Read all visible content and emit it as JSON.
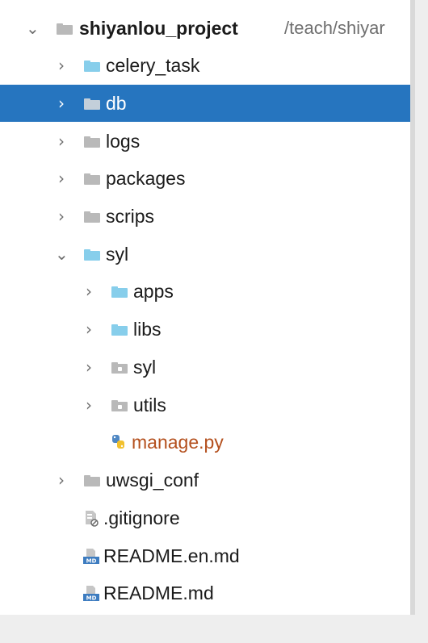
{
  "tree": {
    "root": {
      "name": "shiyanlou_project",
      "path": "/teach/shiyar",
      "expanded": true
    },
    "items": [
      {
        "name": "celery_task",
        "type": "folder",
        "icon": "blue-folder-icon",
        "expanded": false
      },
      {
        "name": "db",
        "type": "folder",
        "icon": "gray-folder-icon",
        "expanded": false,
        "selected": true
      },
      {
        "name": "logs",
        "type": "folder",
        "icon": "gray-folder-icon",
        "expanded": false
      },
      {
        "name": "packages",
        "type": "folder",
        "icon": "gray-folder-icon",
        "expanded": false
      },
      {
        "name": "scrips",
        "type": "folder",
        "icon": "gray-folder-icon",
        "expanded": false
      },
      {
        "name": "syl",
        "type": "folder",
        "icon": "blue-folder-icon",
        "expanded": true
      },
      {
        "name": "apps",
        "type": "folder",
        "icon": "blue-folder-icon",
        "expanded": false
      },
      {
        "name": "libs",
        "type": "folder",
        "icon": "blue-folder-icon",
        "expanded": false
      },
      {
        "name": "syl",
        "type": "folder",
        "icon": "package-folder-icon",
        "expanded": false
      },
      {
        "name": "utils",
        "type": "folder",
        "icon": "package-folder-icon",
        "expanded": false
      },
      {
        "name": "manage.py",
        "type": "file",
        "icon": "python-file-icon"
      },
      {
        "name": "uwsgi_conf",
        "type": "folder",
        "icon": "gray-folder-icon",
        "expanded": false
      },
      {
        "name": ".gitignore",
        "type": "file",
        "icon": "ignore-file-icon"
      },
      {
        "name": "README.en.md",
        "type": "file",
        "icon": "markdown-file-icon"
      },
      {
        "name": "README.md",
        "type": "file",
        "icon": "markdown-file-icon"
      }
    ]
  },
  "colors": {
    "selection": "#2675bf",
    "source_folder": "#87ceeb",
    "folder": "#b9b9b9",
    "python_file_text": "#b4501e"
  }
}
